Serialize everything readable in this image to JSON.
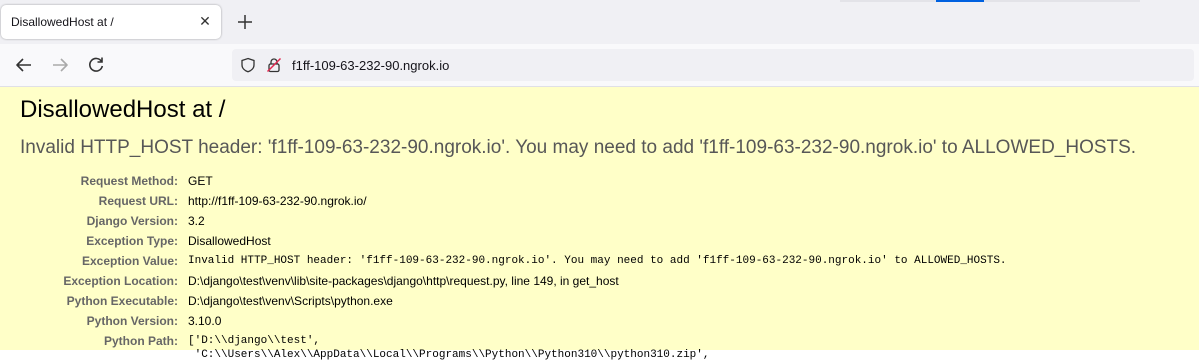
{
  "browser": {
    "tab": {
      "title": "DisallowedHost at /",
      "close_glyph": "✕"
    },
    "address": "f1ff-109-63-232-90.ngrok.io"
  },
  "page": {
    "title": "DisallowedHost at /",
    "summary": "Invalid HTTP_HOST header: 'f1ff-109-63-232-90.ngrok.io'. You may need to add 'f1ff-109-63-232-90.ngrok.io' to ALLOWED_HOSTS.",
    "meta": [
      {
        "label": "Request Method:",
        "value": "GET"
      },
      {
        "label": "Request URL:",
        "value": "http://f1ff-109-63-232-90.ngrok.io/"
      },
      {
        "label": "Django Version:",
        "value": "3.2"
      },
      {
        "label": "Exception Type:",
        "value": "DisallowedHost"
      },
      {
        "label": "Exception Value:",
        "value": "Invalid HTTP_HOST header: 'f1ff-109-63-232-90.ngrok.io'. You may need to add 'f1ff-109-63-232-90.ngrok.io' to ALLOWED_HOSTS."
      },
      {
        "label": "Exception Location:",
        "value": "D:\\django\\test\\venv\\lib\\site-packages\\django\\http\\request.py, line 149, in get_host"
      },
      {
        "label": "Python Executable:",
        "value": "D:\\django\\test\\venv\\Scripts\\python.exe"
      },
      {
        "label": "Python Version:",
        "value": "3.10.0"
      },
      {
        "label": "Python Path:",
        "value": "['D:\\\\django\\\\test',\n 'C:\\\\Users\\\\Alex\\\\AppData\\\\Local\\\\Programs\\\\Python\\\\Python310\\\\python310.zip',"
      }
    ]
  },
  "colors": {
    "content_bg": "#ffffc8",
    "accent": "#0061e0"
  }
}
